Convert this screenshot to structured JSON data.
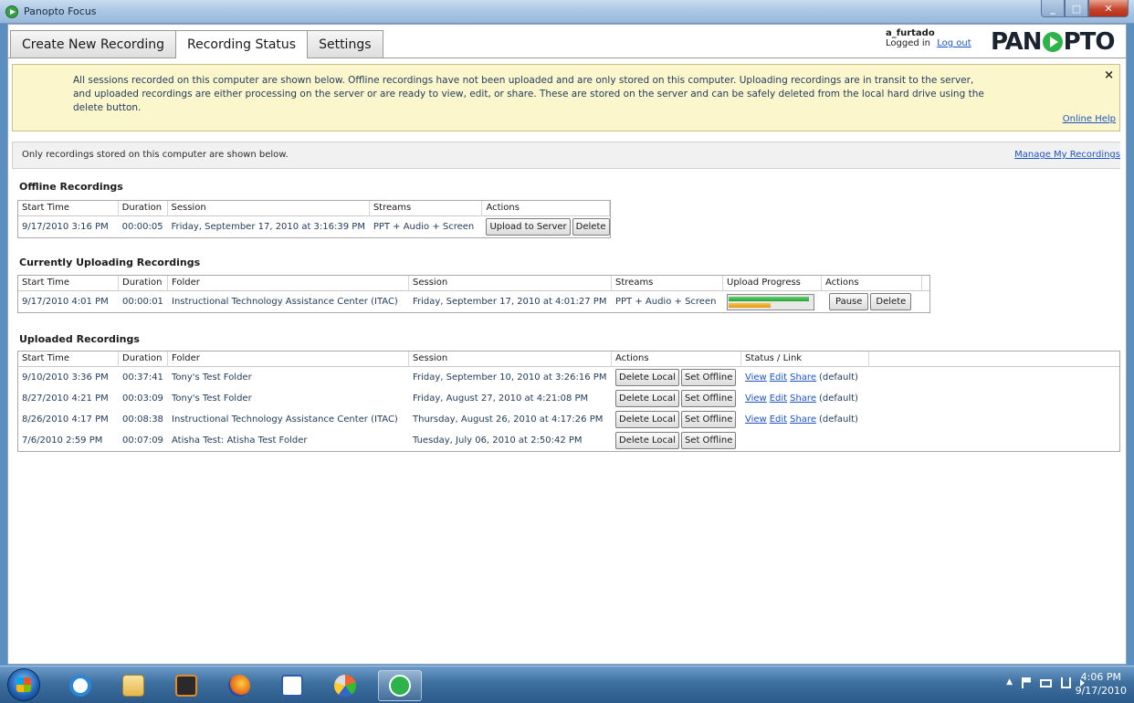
{
  "window": {
    "title": "Panopto Focus"
  },
  "tabs": [
    "Create New Recording",
    "Recording Status",
    "Settings"
  ],
  "user": {
    "name": "a_furtado",
    "status": "Logged in",
    "logout_label": "Log out"
  },
  "logo": {
    "left": "PAN",
    "right": "PTO"
  },
  "banner": {
    "text": "All sessions recorded on this computer are shown below.  Offline recordings have not been uploaded and are only stored on this computer.  Uploading recordings are in transit to the server, and uploaded recordings are either processing on the server or are ready to view, edit, or share.  These are stored on the server and can be safely deleted from the local hard drive using the delete button.",
    "close_label": "×",
    "help_label": "Online Help"
  },
  "notice": {
    "text": "Only recordings stored on this computer are shown below.",
    "manage_label": "Manage My Recordings"
  },
  "offline": {
    "title": "Offline Recordings",
    "headers": [
      "Start Time",
      "Duration",
      "Session",
      "Streams",
      "Actions"
    ],
    "rows": [
      {
        "start": "9/17/2010 3:16 PM",
        "duration": "00:00:05",
        "session": "Friday, September 17, 2010 at 3:16:39 PM",
        "streams": "PPT + Audio + Screen",
        "upload_label": "Upload to Server",
        "delete_label": "Delete"
      }
    ]
  },
  "uploading": {
    "title": "Currently Uploading Recordings",
    "headers": [
      "Start Time",
      "Duration",
      "Folder",
      "Session",
      "Streams",
      "Upload Progress",
      "Actions"
    ],
    "rows": [
      {
        "start": "9/17/2010 4:01 PM",
        "duration": "00:00:01",
        "folder": "Instructional Technology Assistance Center (ITAC)",
        "session": "Friday, September 17, 2010 at 4:01:27 PM",
        "streams": "PPT + Audio + Screen",
        "progress_primary": 0.96,
        "progress_secondary": 0.5,
        "pause_label": "Pause",
        "delete_label": "Delete"
      }
    ]
  },
  "uploaded": {
    "title": "Uploaded Recordings",
    "headers": [
      "Start Time",
      "Duration",
      "Folder",
      "Session",
      "Actions",
      "Status / Link"
    ],
    "delete_local_label": "Delete Local",
    "set_offline_label": "Set Offline",
    "view_label": "View",
    "edit_label": "Edit",
    "share_label": "Share",
    "default_label": "(default)",
    "rows": [
      {
        "start": "9/10/2010 3:36 PM",
        "duration": "00:37:41",
        "folder": "Tony's Test Folder",
        "session": "Friday, September 10, 2010 at 3:26:16 PM",
        "has_links": true
      },
      {
        "start": "8/27/2010 4:21 PM",
        "duration": "00:03:09",
        "folder": "Tony's Test Folder",
        "session": "Friday, August 27, 2010 at 4:21:08 PM",
        "has_links": true
      },
      {
        "start": "8/26/2010 4:17 PM",
        "duration": "00:08:38",
        "folder": "Instructional Technology Assistance Center (ITAC)",
        "session": "Thursday, August 26, 2010 at 4:17:26 PM",
        "has_links": true
      },
      {
        "start": "7/6/2010 2:59 PM",
        "duration": "00:07:09",
        "folder": "Atisha Test: Atisha Test Folder",
        "session": "Tuesday, July 06, 2010 at 2:50:42 PM",
        "has_links": false
      }
    ]
  },
  "taskbar": {
    "icons": [
      "ie-icon",
      "explorer-folder-icon",
      "media-player-icon",
      "firefox-icon",
      "word-icon",
      "paint-icon",
      "panopto-icon"
    ],
    "time": "4:06 PM",
    "date": "9/17/2010"
  }
}
